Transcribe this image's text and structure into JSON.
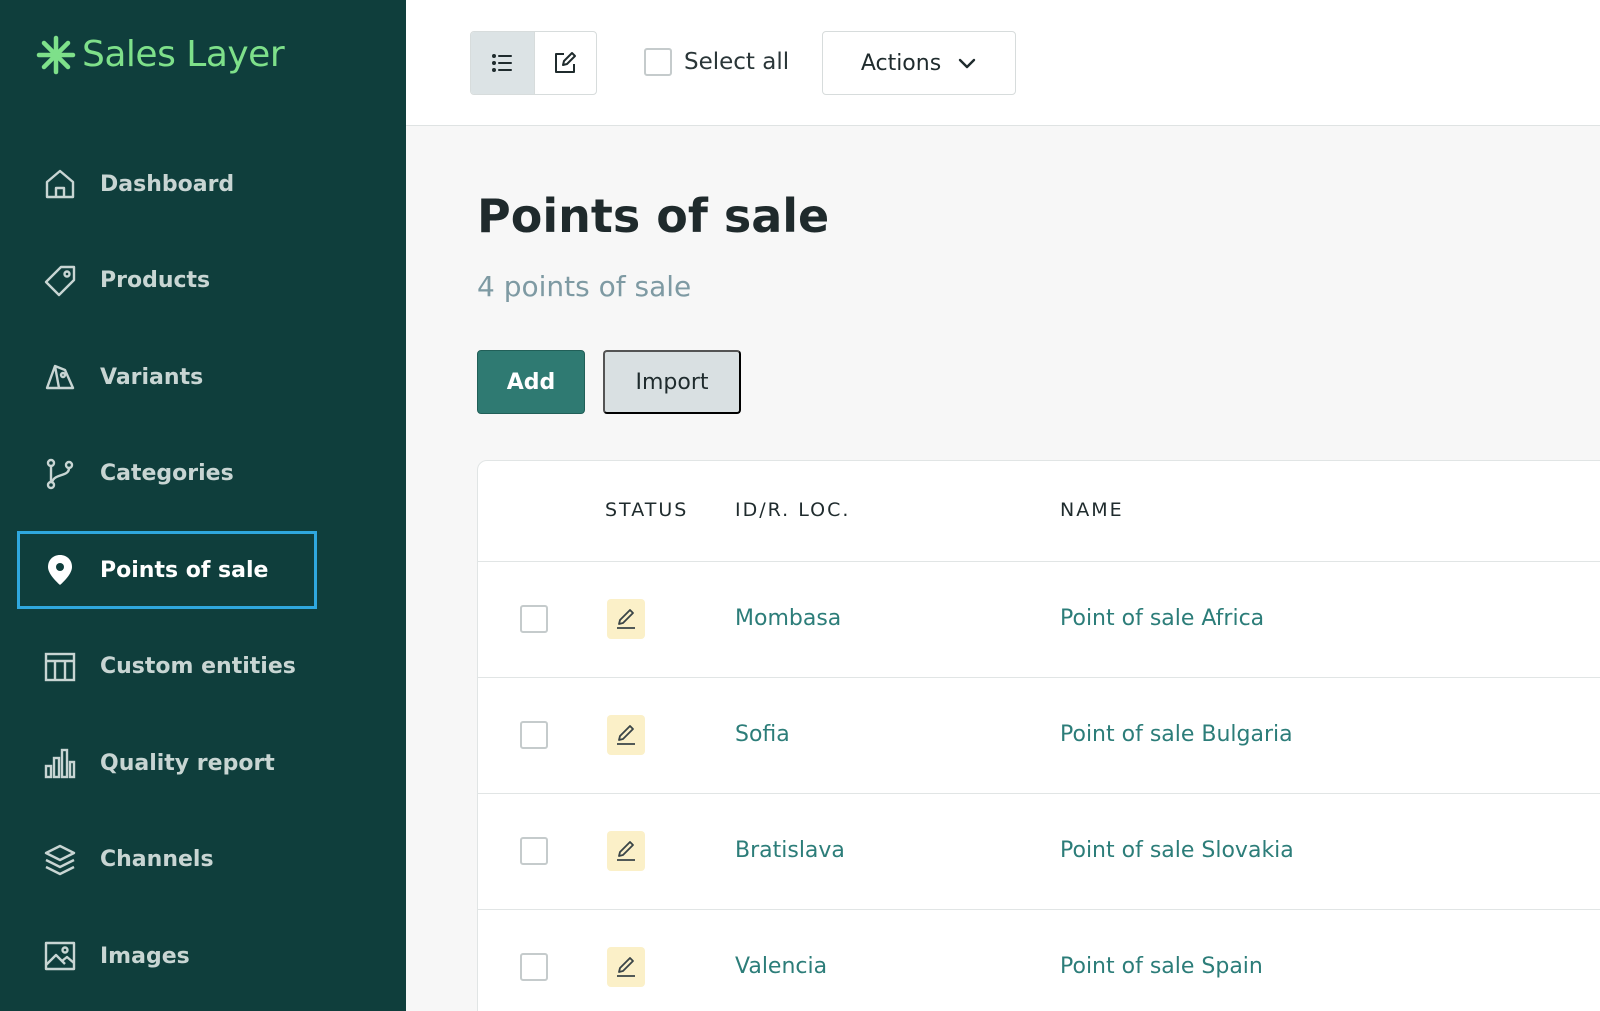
{
  "app": {
    "logo_text": "Sales Layer",
    "brand_color": "#7ee08a",
    "sidebar_bg": "#0f3e3c"
  },
  "sidebar": {
    "items": [
      {
        "label": "Dashboard",
        "icon": "home-icon",
        "active": false
      },
      {
        "label": "Products",
        "icon": "tag-icon",
        "active": false
      },
      {
        "label": "Variants",
        "icon": "variants-tags-icon",
        "active": false
      },
      {
        "label": "Categories",
        "icon": "branch-icon",
        "active": false
      },
      {
        "label": "Points of sale",
        "icon": "map-pin-icon",
        "active": true
      },
      {
        "label": "Custom entities",
        "icon": "table-grid-icon",
        "active": false
      },
      {
        "label": "Quality report",
        "icon": "bar-chart-icon",
        "active": false
      },
      {
        "label": "Channels",
        "icon": "layers-icon",
        "active": false
      },
      {
        "label": "Images",
        "icon": "image-icon",
        "active": false
      }
    ]
  },
  "toolbar": {
    "view_list_icon": "list-icon",
    "view_edit_icon": "edit-square-icon",
    "select_all_label": "Select all",
    "actions_label": "Actions"
  },
  "main": {
    "title": "Points of sale",
    "subtitle": "4 points of sale",
    "add_label": "Add",
    "import_label": "Import",
    "accent_color": "#2f7a72"
  },
  "table": {
    "columns": [
      "STATUS",
      "ID/R. LOC.",
      "NAME"
    ],
    "rows": [
      {
        "status_icon": "pencil-icon",
        "id": "Mombasa",
        "name": "Point of sale Africa"
      },
      {
        "status_icon": "pencil-icon",
        "id": "Sofia",
        "name": "Point of sale Bulgaria"
      },
      {
        "status_icon": "pencil-icon",
        "id": "Bratislava",
        "name": "Point of sale Slovakia"
      },
      {
        "status_icon": "pencil-icon",
        "id": "Valencia",
        "name": "Point of sale Spain"
      }
    ]
  }
}
